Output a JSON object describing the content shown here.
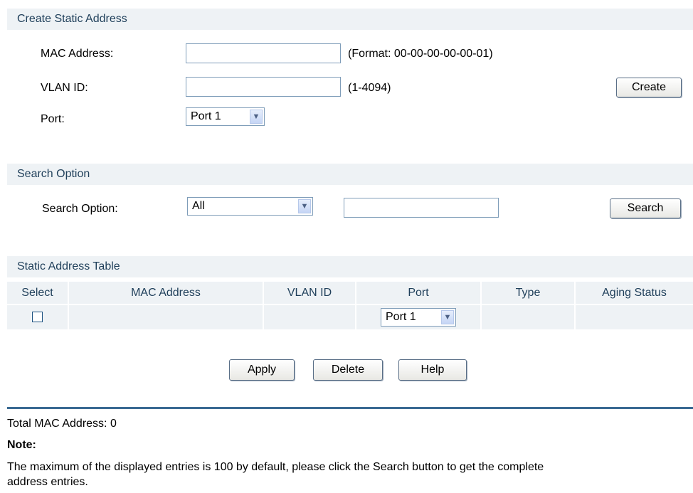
{
  "create_section": {
    "title": "Create Static Address",
    "mac_label": "MAC Address:",
    "mac_value": "",
    "mac_hint": "(Format: 00-00-00-00-00-01)",
    "vlan_label": "VLAN ID:",
    "vlan_value": "",
    "vlan_hint": "(1-4094)",
    "port_label": "Port:",
    "port_value": "Port 1",
    "create_button": "Create"
  },
  "search_section": {
    "title": "Search Option",
    "label": "Search Option:",
    "option_value": "All",
    "search_value": "",
    "search_button": "Search"
  },
  "table_section": {
    "title": "Static Address Table",
    "columns": [
      "Select",
      "MAC Address",
      "VLAN ID",
      "Port",
      "Type",
      "Aging Status"
    ],
    "row": {
      "selected": false,
      "mac": "",
      "vlan": "",
      "port": "Port 1",
      "type": "",
      "aging": ""
    }
  },
  "actions": {
    "apply": "Apply",
    "delete": "Delete",
    "help": "Help"
  },
  "footer": {
    "total": "Total MAC Address: 0",
    "note_title": "Note:",
    "note_line1": "The maximum of the displayed entries is 100 by default, please click the Search button to get the complete",
    "note_line2": "address entries."
  },
  "colors": {
    "header_bg": "#eef2f5",
    "header_text": "#1f3f5a",
    "divider": "#3a6a93"
  }
}
